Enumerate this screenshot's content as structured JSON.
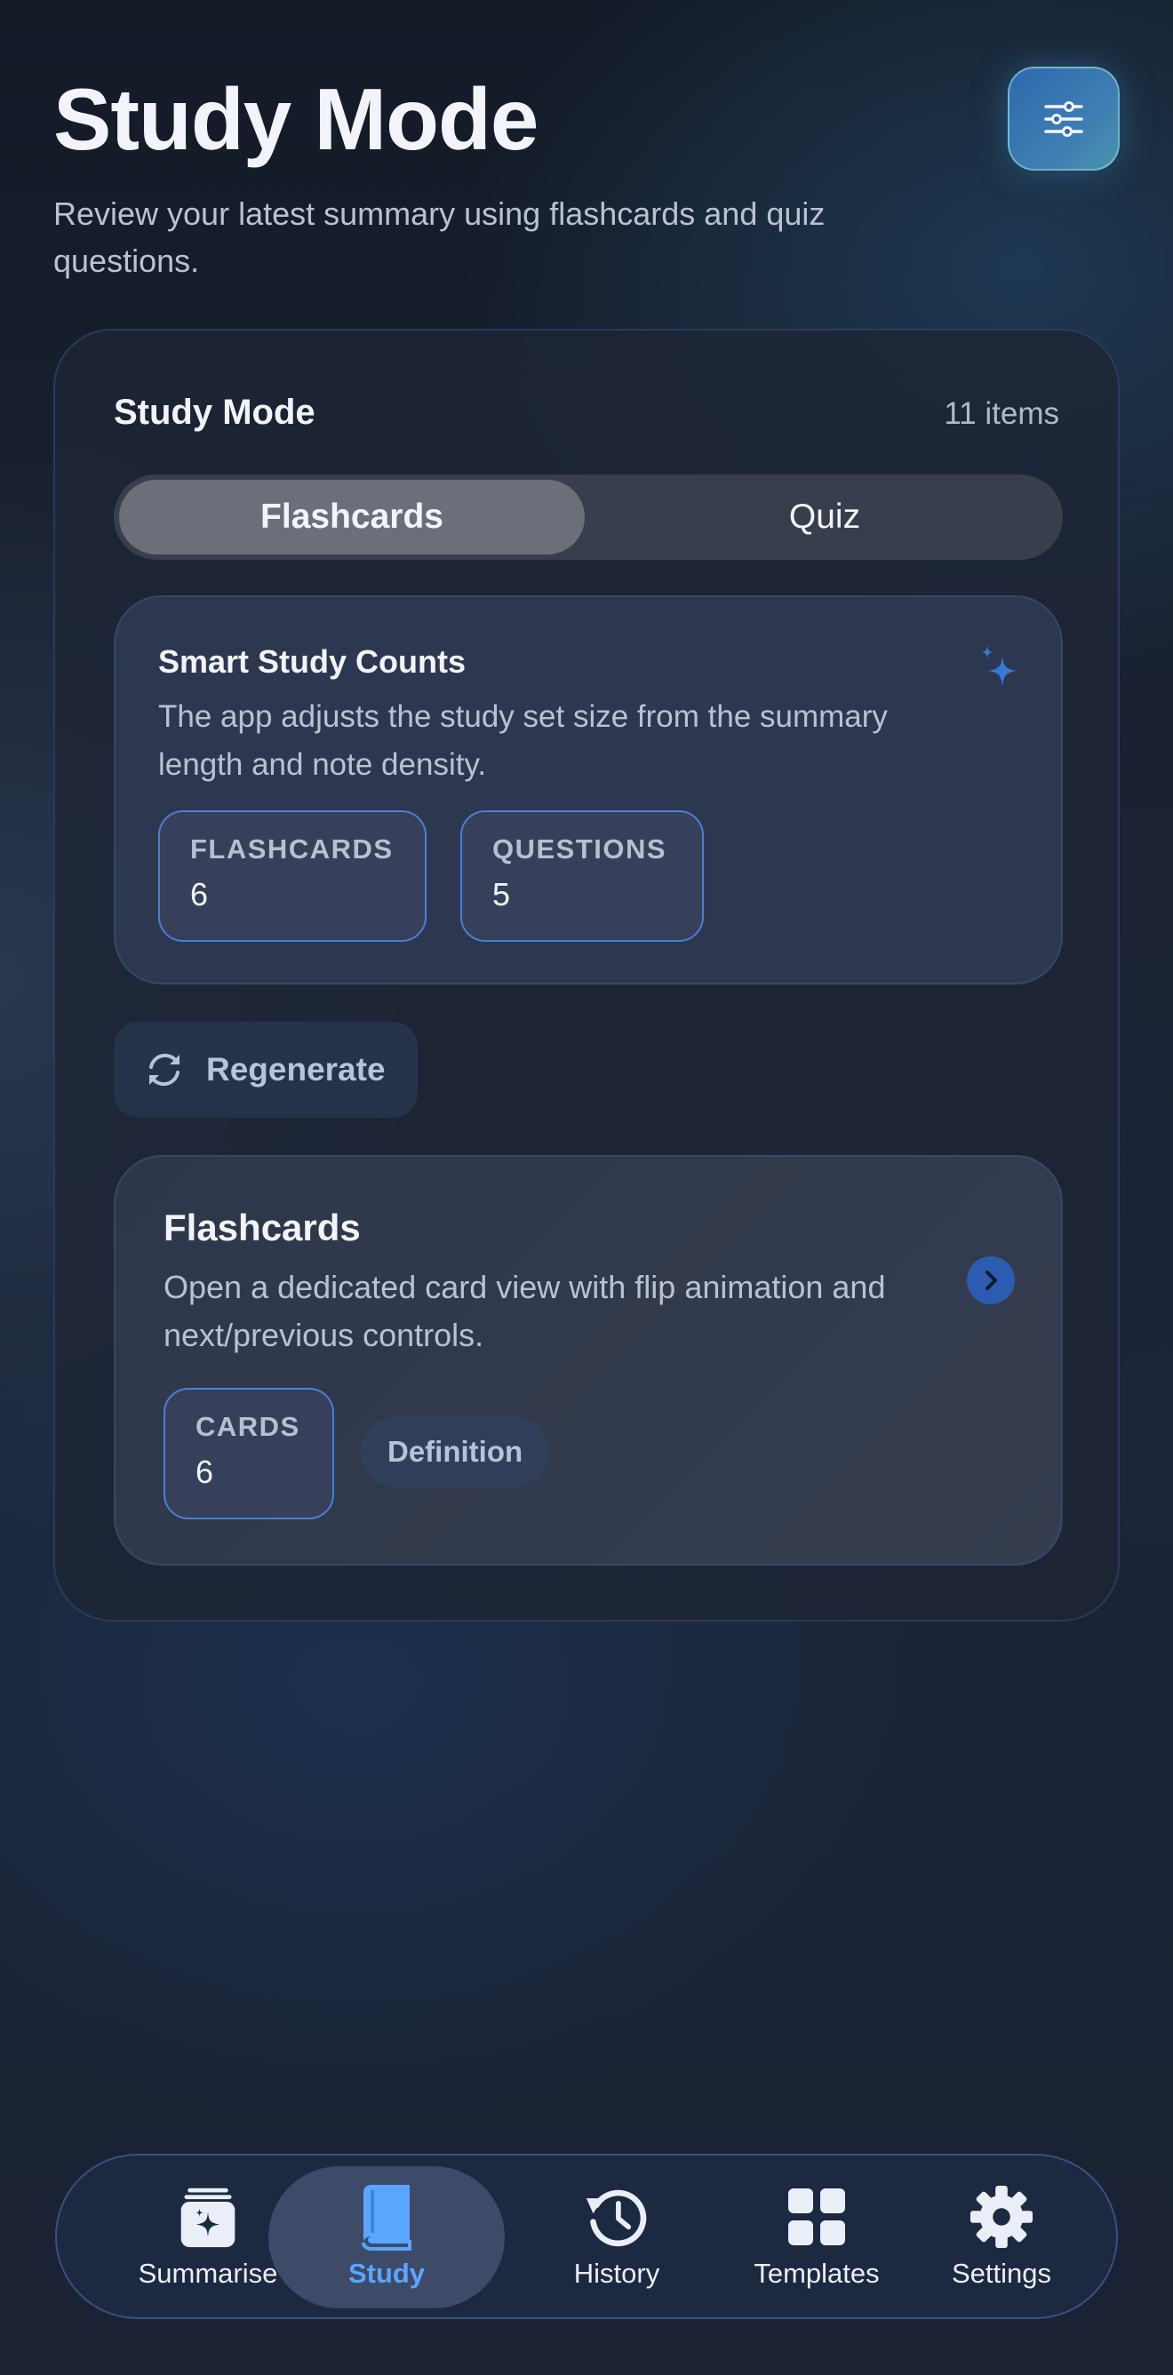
{
  "header": {
    "title": "Study Mode",
    "subtitle": "Review your latest summary using flashcards and quiz questions.",
    "filter_icon": "sliders-icon"
  },
  "study_card": {
    "title": "Study Mode",
    "item_count": "11 items",
    "tabs": [
      {
        "label": "Flashcards",
        "selected": true
      },
      {
        "label": "Quiz",
        "selected": false
      }
    ],
    "smart_counts": {
      "title": "Smart Study Counts",
      "description": "The app adjusts the study set size from the summary length and note density.",
      "icon": "sparkle-icon",
      "stats": [
        {
          "label": "FLASHCARDS",
          "value": "6"
        },
        {
          "label": "QUESTIONS",
          "value": "5"
        }
      ]
    },
    "regenerate": {
      "label": "Regenerate",
      "icon": "refresh-icon"
    },
    "flashcards_panel": {
      "title": "Flashcards",
      "description": "Open a dedicated card view with flip animation and next/previous controls.",
      "cards_label": "CARDS",
      "cards_value": "6",
      "tag": "Definition",
      "chevron_icon": "chevron-right-icon"
    }
  },
  "bottom_nav": {
    "items": [
      {
        "label": "Summarise",
        "icon": "summarise-icon",
        "active": false
      },
      {
        "label": "Study",
        "icon": "book-icon",
        "active": true
      },
      {
        "label": "History",
        "icon": "history-icon",
        "active": false
      },
      {
        "label": "Templates",
        "icon": "grid-icon",
        "active": false
      },
      {
        "label": "Settings",
        "icon": "gear-icon",
        "active": false
      }
    ]
  },
  "colors": {
    "accent": "#5aa6ff",
    "chip_border": "#4a7fd6",
    "background": "#1a2233"
  }
}
